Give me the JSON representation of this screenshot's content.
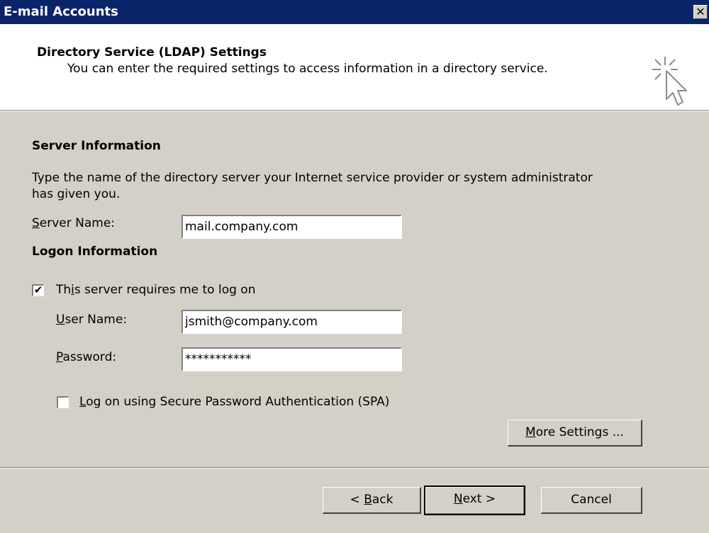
{
  "window": {
    "title": "E-mail Accounts",
    "close_glyph": "✕"
  },
  "header": {
    "title": "Directory Service (LDAP) Settings",
    "subtitle": "You can enter the required settings to access information in a directory service.",
    "icon": "wizard-cursor-icon"
  },
  "server": {
    "section_title": "Server Information",
    "description_line1": "Type the name of the directory server your Internet service provider or system administrator",
    "description_line2": "has given you.",
    "label_accel": "S",
    "label_rest": "erver Name:",
    "value": "mail.company.com"
  },
  "logon": {
    "section_title": "Logon Information",
    "requires_logon": {
      "text_pre": "Th",
      "accel": "i",
      "text_post": "s server requires me to log on",
      "checked": true,
      "check_glyph": "✔"
    },
    "username": {
      "label_accel": "U",
      "label_rest": "ser Name:",
      "value": "jsmith@company.com"
    },
    "password": {
      "label_accel": "P",
      "label_rest": "assword:",
      "value": "***********"
    },
    "spa": {
      "accel": "L",
      "text_rest": "og on using Secure Password Authentication (SPA)",
      "checked": false
    },
    "more_settings": {
      "accel": "M",
      "rest": "ore Settings ..."
    }
  },
  "footer": {
    "back": {
      "pre": "< ",
      "accel": "B",
      "rest": "ack"
    },
    "next": {
      "accel": "N",
      "rest": "ext >"
    },
    "cancel": "Cancel"
  }
}
